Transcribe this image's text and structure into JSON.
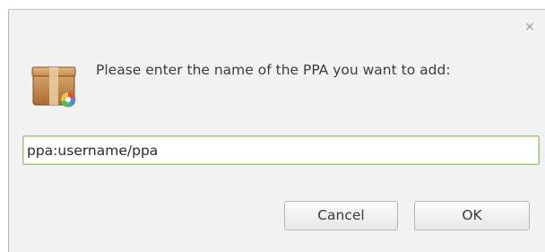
{
  "dialog": {
    "close_symbol": "×",
    "icon": "package-icon",
    "prompt": "Please enter the name of the PPA you want to add:",
    "input": {
      "value": "ppa:username/ppa",
      "placeholder": ""
    },
    "buttons": {
      "cancel_label": "Cancel",
      "ok_label": "OK"
    },
    "colors": {
      "focus_border": "#9fc66a",
      "dialog_bg": "#f2f2f2"
    }
  }
}
